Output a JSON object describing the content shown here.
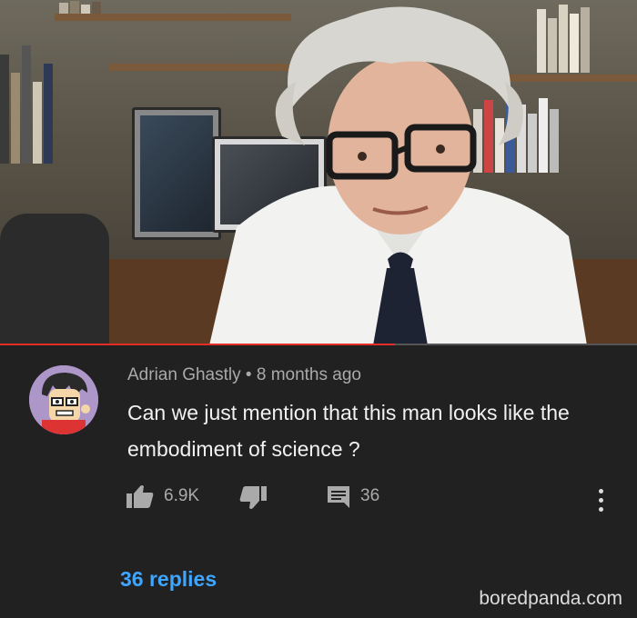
{
  "video": {
    "progress_fraction": 0.62
  },
  "comment": {
    "author": "Adrian Ghastly",
    "separator": "•",
    "timestamp": "8 months ago",
    "text": "Can we just mention that this man looks like the embodiment of science ?",
    "likes": "6.9K",
    "reply_count": "36",
    "replies_link": "36 replies"
  },
  "icons": {
    "like": "thumb-up-icon",
    "dislike": "thumb-down-icon",
    "reply": "comment-icon",
    "menu": "more-vert-icon"
  },
  "watermark": "boredpanda.com",
  "colors": {
    "background": "#212121",
    "link": "#3ea6ff",
    "progress": "#e52d27",
    "avatar_bg": "#ad97c9"
  }
}
